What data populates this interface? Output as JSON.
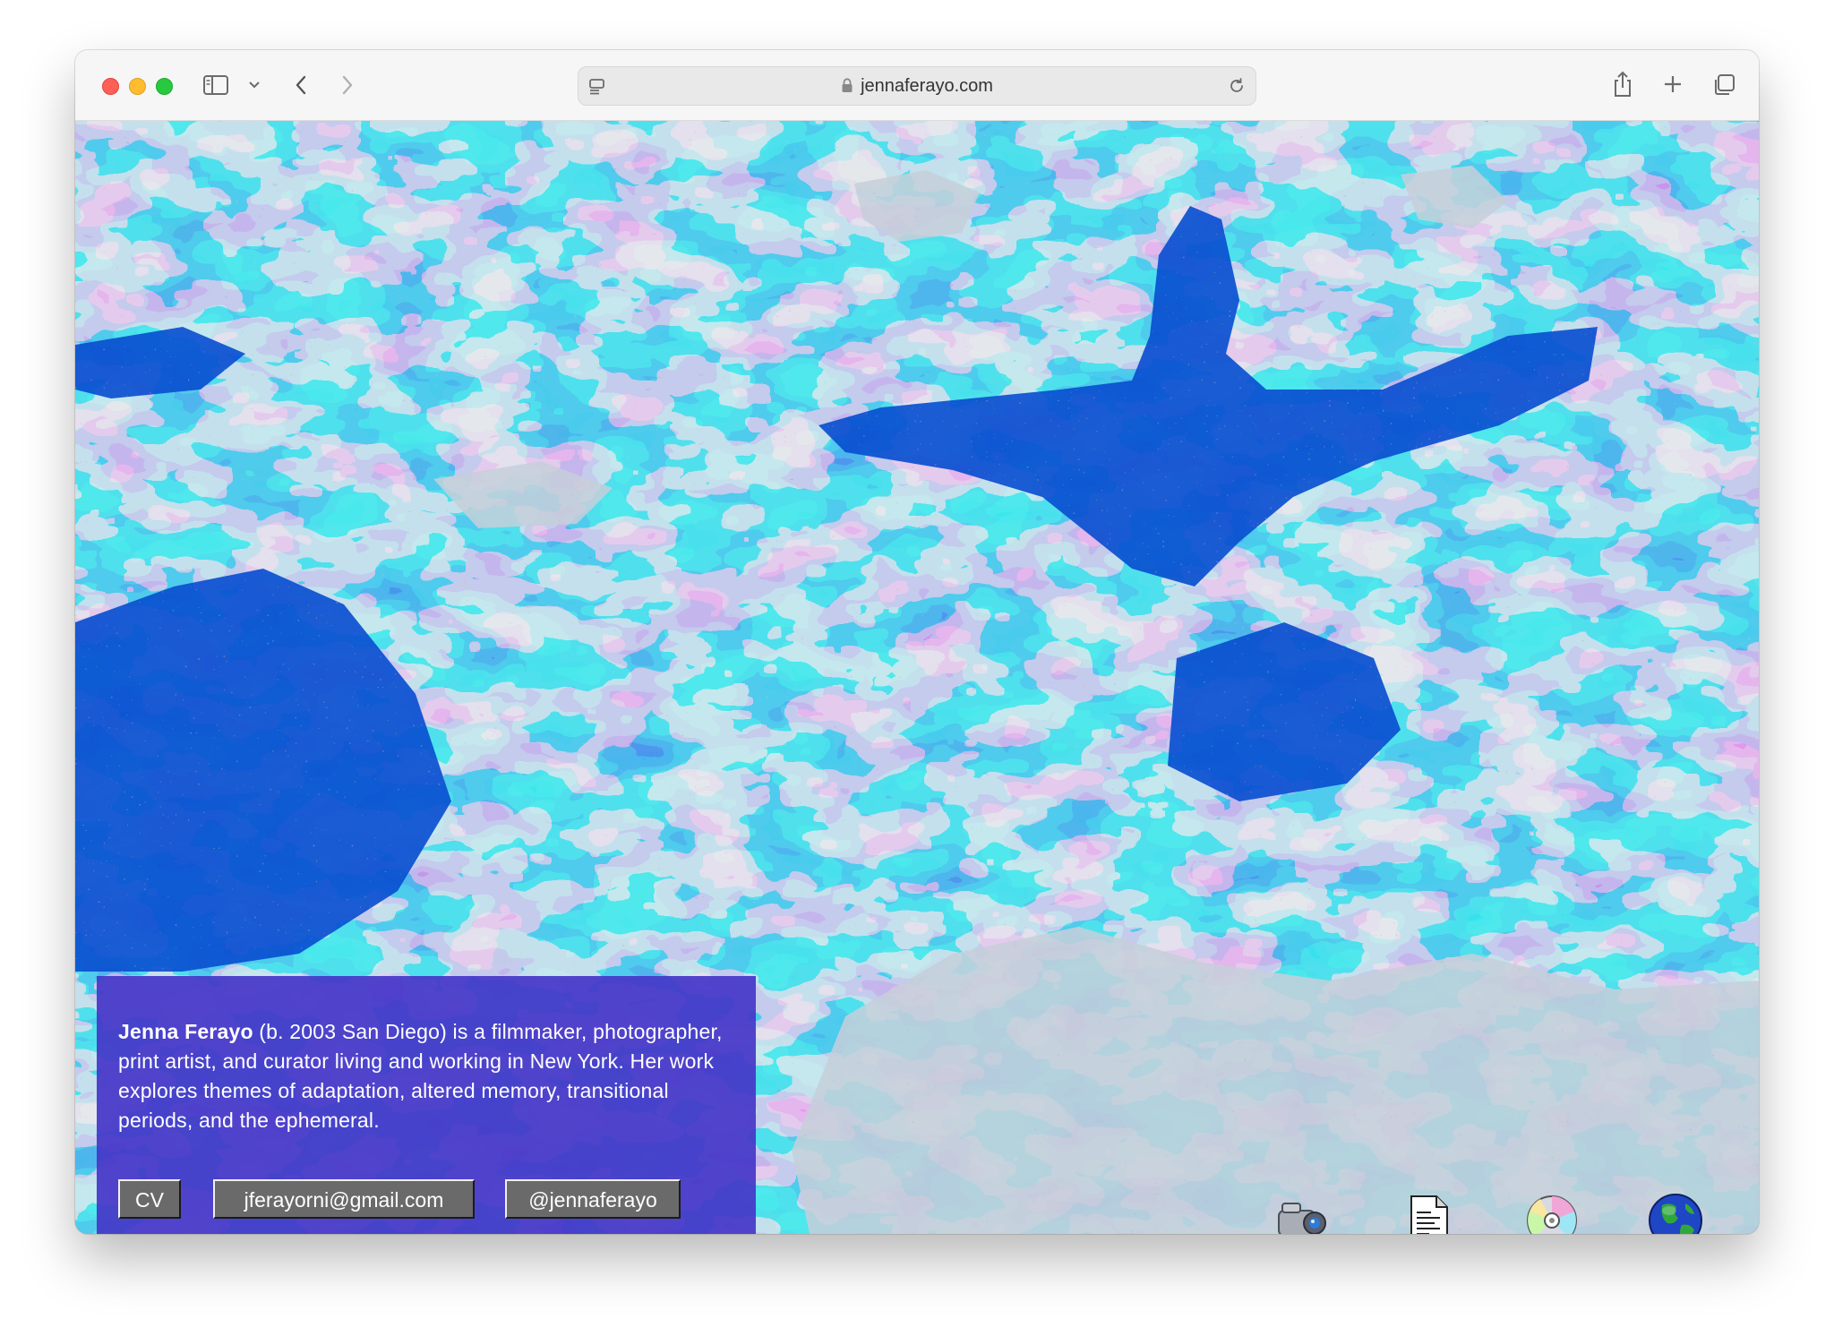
{
  "browser": {
    "url": "jennaferayo.com"
  },
  "bio": {
    "name": "Jenna Ferayo",
    "text": " (b. 2003 San Diego) is a filmmaker, photographer, print artist, and curator living and working in New York. Her work explores themes of adaptation, altered memory, transitional periods, and the ephemeral."
  },
  "links": {
    "cv": "CV",
    "email": "jferayorni@gmail.com",
    "handle": "@jennaferayo"
  },
  "dock": {
    "icons": [
      "camcorder-icon",
      "document-icon",
      "cd-icon",
      "globe-icon"
    ]
  },
  "colors": {
    "deep_blue": "#0a4fd0",
    "mid_blue": "#1677d4",
    "cyan": "#13bfd8",
    "pale": "#c6cfd9",
    "panel": "#4637c8"
  }
}
